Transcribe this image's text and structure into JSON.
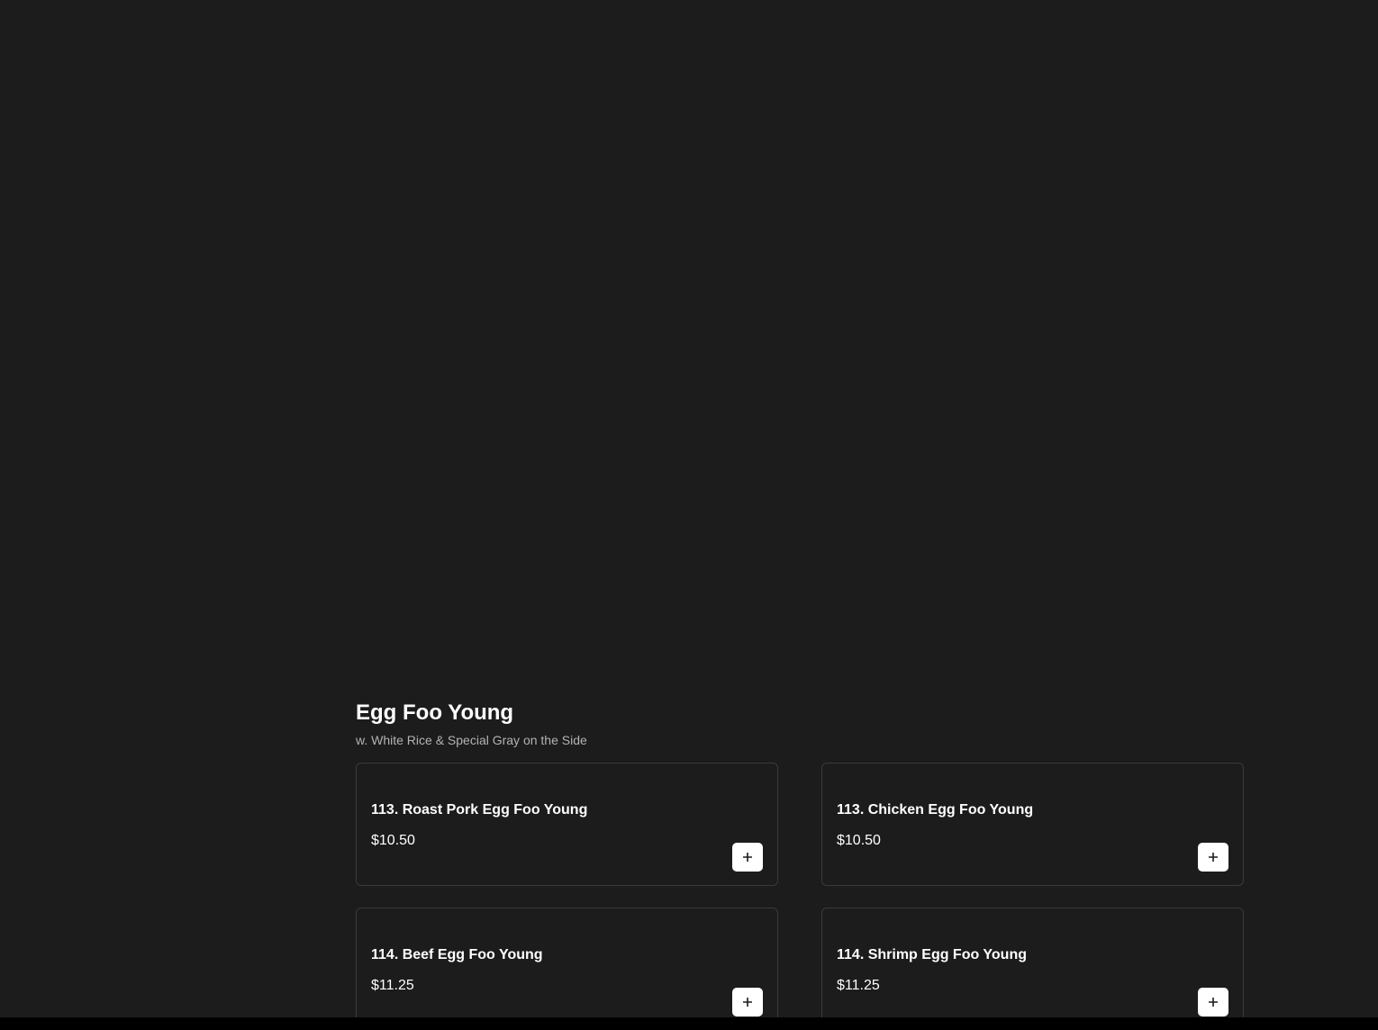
{
  "section": {
    "title": "Egg Foo Young",
    "subtitle": "w. White Rice & Special Gray on the Side"
  },
  "items": [
    {
      "name": "113. Roast Pork Egg Foo Young",
      "price": "$10.50",
      "add_icon": "plus-icon"
    },
    {
      "name": "113. Chicken Egg Foo Young",
      "price": "$10.50",
      "add_icon": "plus-icon"
    },
    {
      "name": "114. Beef Egg Foo Young",
      "price": "$11.25",
      "add_icon": "plus-icon"
    },
    {
      "name": "114. Shrimp Egg Foo Young",
      "price": "$11.25",
      "add_icon": "plus-icon"
    }
  ],
  "colors": {
    "background": "#1c1c1c",
    "card_border": "#3a3a3a",
    "text": "#ffffff",
    "subtext": "#b3b3b3",
    "button": "#ffffff"
  }
}
